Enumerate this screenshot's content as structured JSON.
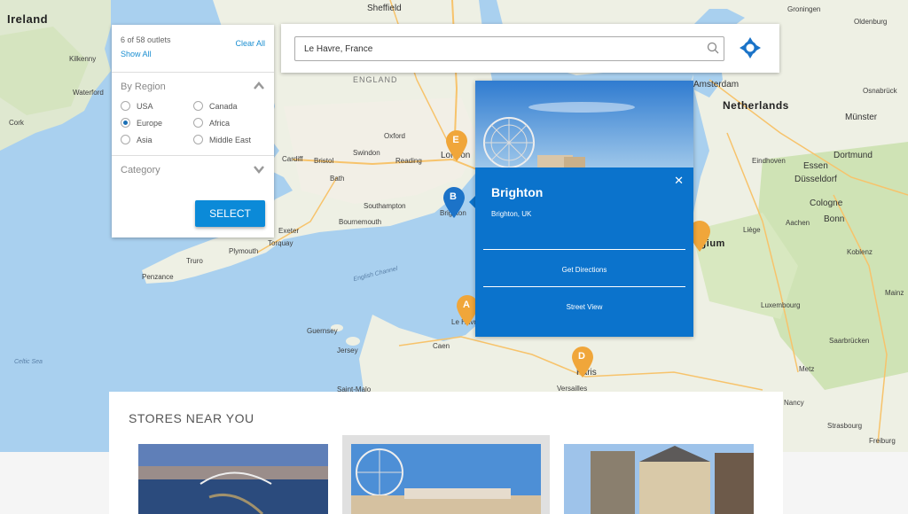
{
  "filter": {
    "count_text": "6 of 58 outlets",
    "clear_all": "Clear All",
    "show_all": "Show All",
    "by_region_label": "By Region",
    "regions": [
      {
        "label": "USA",
        "selected": false
      },
      {
        "label": "Canada",
        "selected": false
      },
      {
        "label": "Europe",
        "selected": true
      },
      {
        "label": "Africa",
        "selected": false
      },
      {
        "label": "Asia",
        "selected": false
      },
      {
        "label": "Middle East",
        "selected": false
      }
    ],
    "category_label": "Category",
    "select_button": "SELECT"
  },
  "search": {
    "value": "Le Havre, France",
    "search_icon": "search-icon",
    "locate_icon": "crosshair-icon"
  },
  "popup": {
    "name": "Brighton",
    "location": "Brighton, UK",
    "get_directions": "Get Directions",
    "street_view": "Street View",
    "close_icon": "close-icon"
  },
  "markers": [
    {
      "letter": "E",
      "color": "#f0a63a"
    },
    {
      "letter": "B",
      "color": "#1c73c8"
    },
    {
      "letter": "A",
      "color": "#f0a63a"
    },
    {
      "letter": "D",
      "color": "#f0a63a"
    },
    {
      "letter": "",
      "color": "#f0a63a"
    }
  ],
  "map_labels": {
    "ireland": "Ireland",
    "england": "ENGLAND",
    "netherlands": "Netherlands",
    "sheffield": "Sheffield",
    "london": "London",
    "brighton": "Brighton",
    "southampton": "Southampton",
    "bournemouth": "Bournemouth",
    "plymouth": "Plymouth",
    "oxford": "Oxford",
    "reading": "Reading",
    "swindon": "Swindon",
    "cardiff": "Cardiff",
    "bristol": "Bristol",
    "bath": "Bath",
    "cork": "Cork",
    "waterford": "Waterford",
    "kilkenny": "Kilkenny",
    "amsterdam": "Amsterdam",
    "eindhoven": "Eindhoven",
    "essen": "Essen",
    "dusseldorf": "Düsseldorf",
    "cologne": "Cologne",
    "bonn": "Bonn",
    "dortmund": "Dortmund",
    "munster": "Münster",
    "osnabruck": "Osnabrück",
    "groningen": "Groningen",
    "oldenburg": "Oldenburg",
    "luxembourg": "Luxembourg",
    "saarbrucken": "Saarbrücken",
    "strasbourg": "Strasbourg",
    "english_channel": "English Channel",
    "celtic_sea": "Celtic Sea",
    "guernsey": "Guernsey",
    "jersey": "Jersey",
    "caen": "Caen",
    "paris": "Paris",
    "versailles": "Versailles",
    "saint_malo": "Saint-Malo",
    "le_havre": "Le Havre",
    "belgium": "lgium",
    "penzance": "Penzance",
    "truro": "Truro",
    "torquay": "Torquay",
    "exeter": "Exeter",
    "aachen": "Aachen",
    "liege": "Liège",
    "metz": "Metz",
    "nancy": "Nancy",
    "koblenz": "Koblenz",
    "mainz": "Mainz",
    "freiburg": "Freiburg"
  },
  "stores": {
    "title": "STORES NEAR YOU"
  }
}
